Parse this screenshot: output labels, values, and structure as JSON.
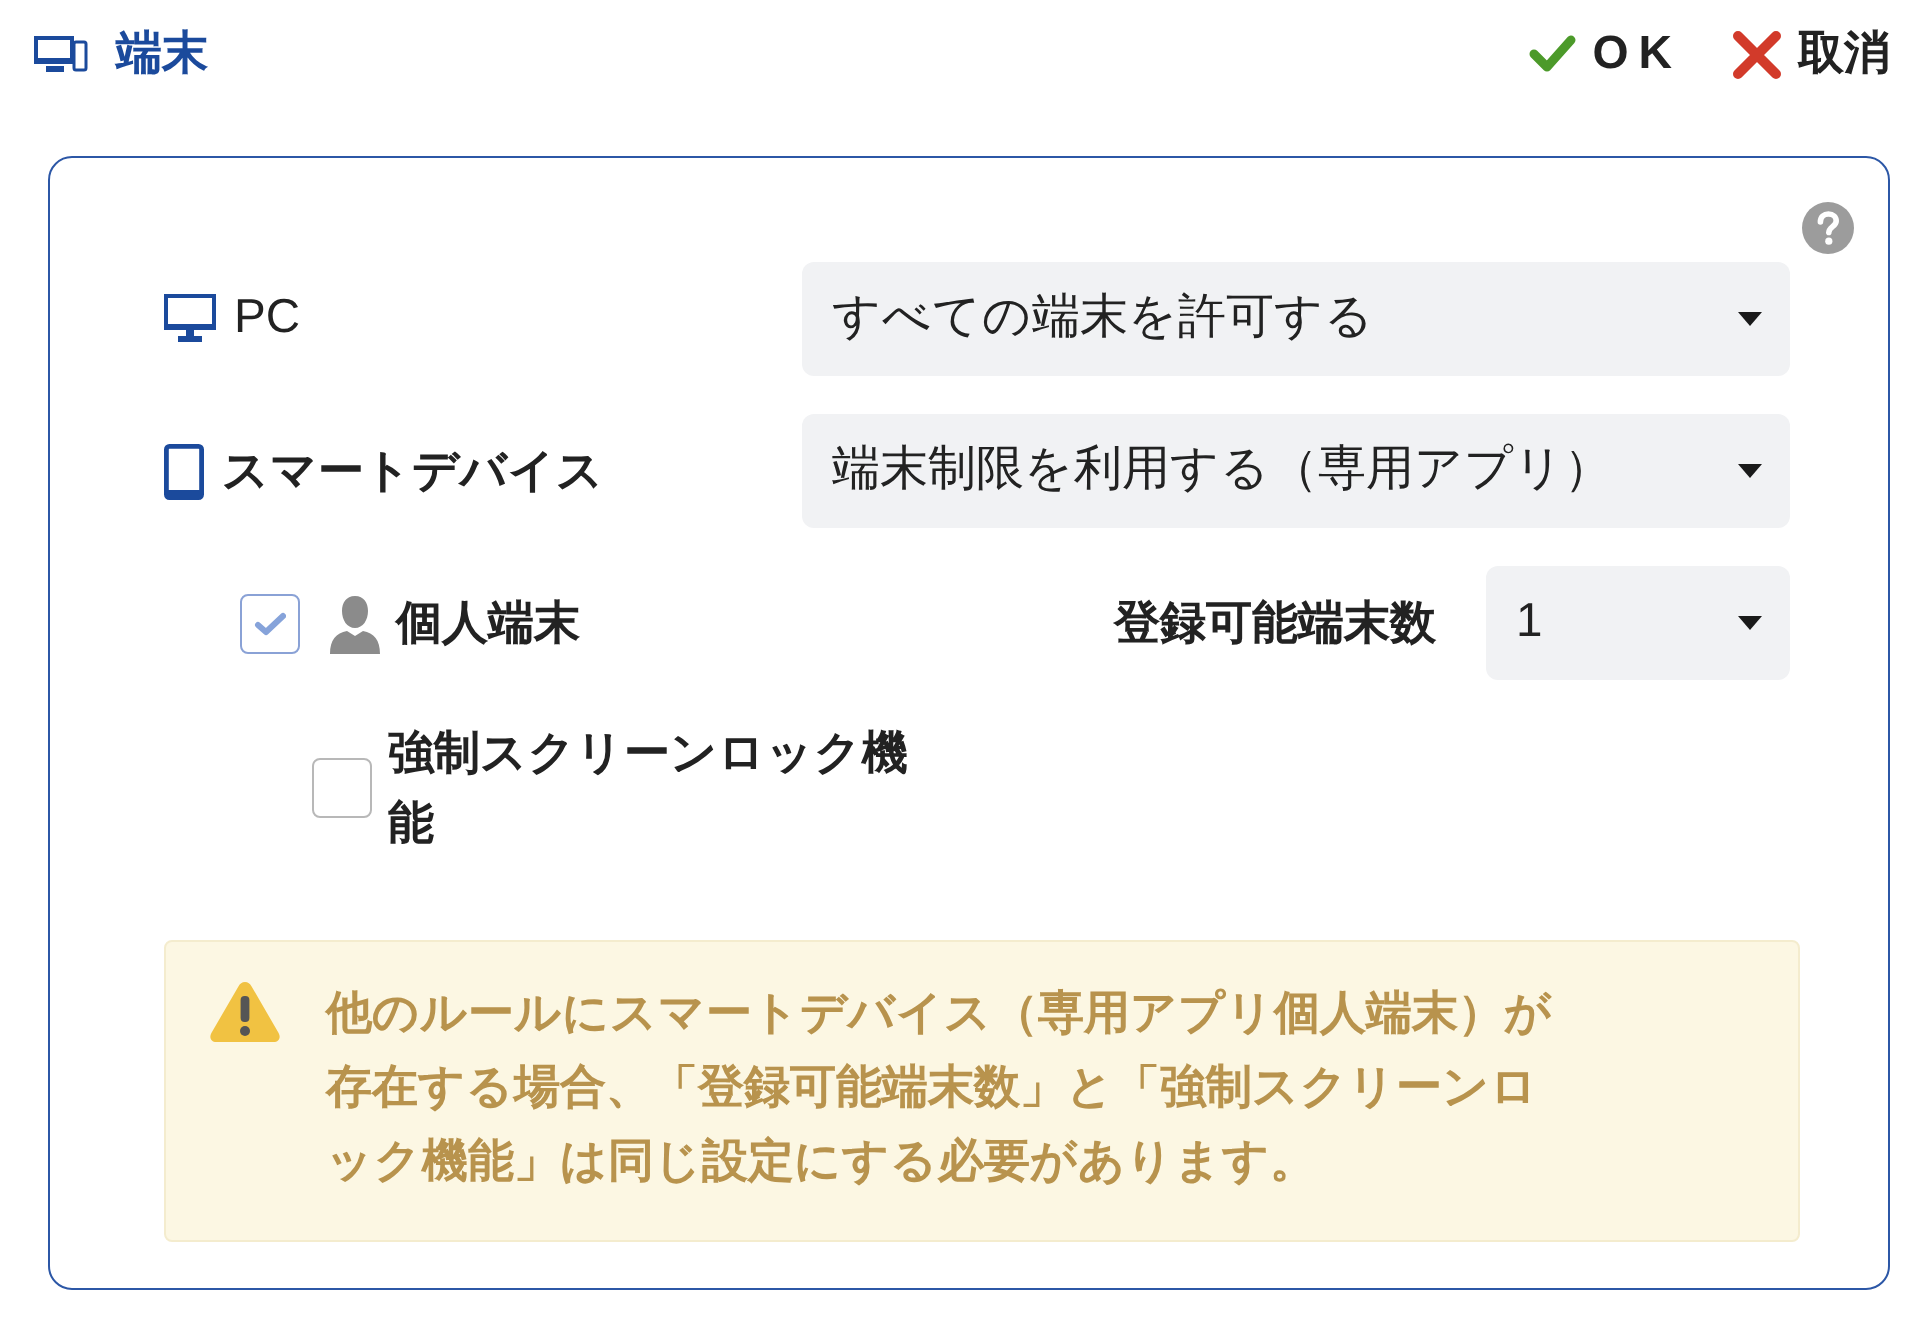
{
  "header": {
    "title": "端末",
    "buttons": [
      {
        "kind": "ok",
        "label": "OK"
      },
      {
        "kind": "cancel",
        "label": "取消"
      }
    ]
  },
  "device_rules": [
    {
      "kind": "pc",
      "label": "PC",
      "value": "すべての端末を許可する"
    },
    {
      "kind": "smart_device",
      "label": "スマートデバイス",
      "value": "端末制限を利用する（専用アプリ）"
    }
  ],
  "personal_device": {
    "label": "個人端末",
    "checked": true,
    "registrable_count": {
      "label": "登録可能端末数",
      "value": "1"
    }
  },
  "screen_lock": {
    "label": "強制スクリーンロック機能",
    "checked": false
  },
  "warning": {
    "text": "他のルールにスマートデバイス（専用アプリ個人端末）が存在する場合、「登録可能端末数」と「強制スクリーンロック機能」は同じ設定にする必要があります。"
  }
}
